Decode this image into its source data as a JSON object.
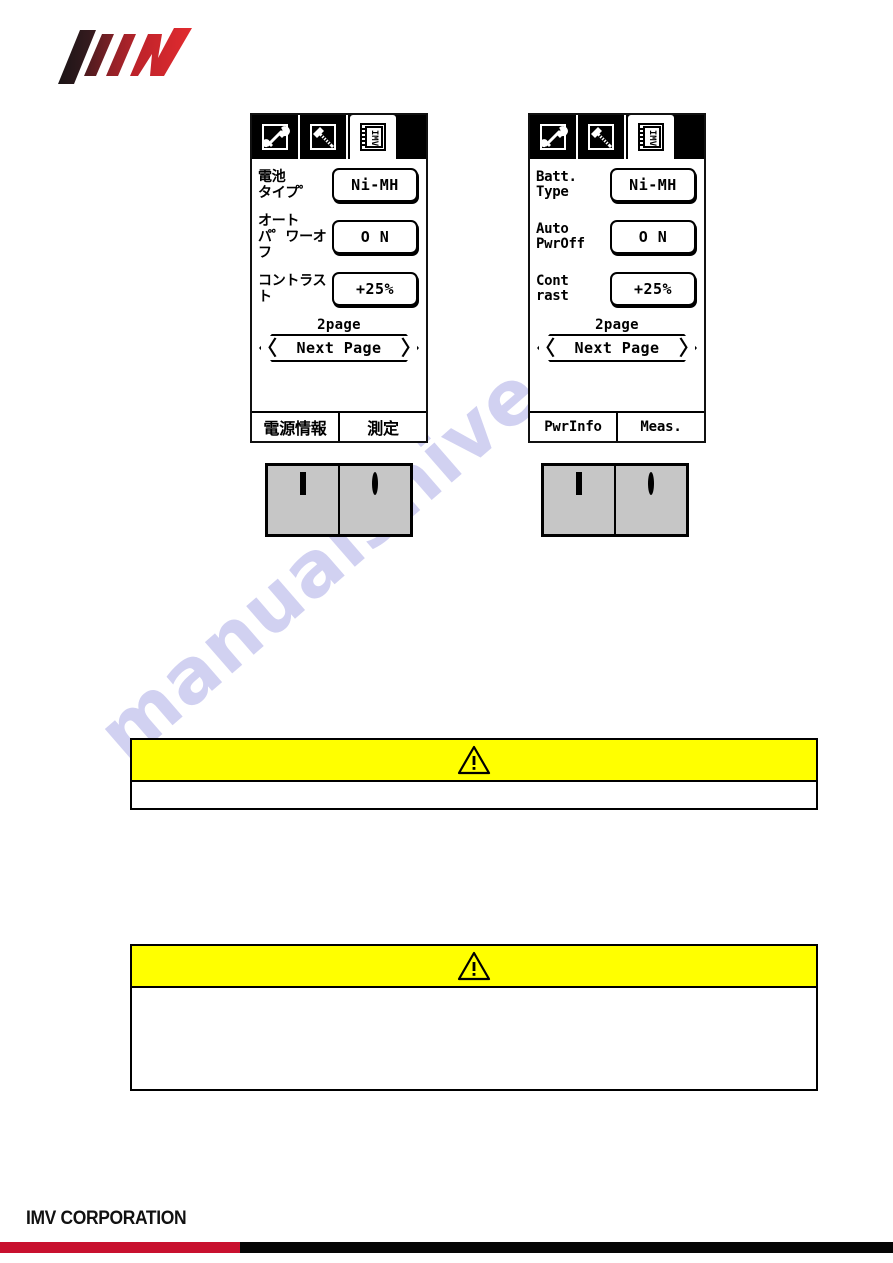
{
  "meta": {
    "watermark": "manualshive.com",
    "brand": "IMV",
    "accent_red": "#c8102e",
    "caution_yellow": "#ffff00",
    "key_panel_gray": "#c6c6c6"
  },
  "footer": {
    "company": "IMV CORPORATION"
  },
  "devices": [
    {
      "id": "japanese",
      "language": "ja",
      "tabs": [
        {
          "icon": "wrench-icon",
          "active": false
        },
        {
          "icon": "screwdriver-icon",
          "active": false
        },
        {
          "icon": "notebook-icon",
          "active": true
        }
      ],
      "settings": [
        {
          "label": "電池\nタイプ゜",
          "value": "Ni-MH"
        },
        {
          "label": "オート\nパ゜ワーオフ",
          "value": "O N"
        },
        {
          "label": "コントラスト",
          "value": "+25%"
        }
      ],
      "page_label": "2page",
      "next_page": "Next Page",
      "arrow_left": "〈",
      "arrow_right": "〉",
      "bottom_tabs": [
        {
          "label": "電源情報",
          "selected": true
        },
        {
          "label": "測定",
          "selected": false
        }
      ],
      "keys": [
        {
          "glyph": "square-icon"
        },
        {
          "glyph": "circle-icon"
        }
      ]
    },
    {
      "id": "english",
      "language": "en",
      "tabs": [
        {
          "icon": "wrench-icon",
          "active": false
        },
        {
          "icon": "screwdriver-icon",
          "active": false
        },
        {
          "icon": "notebook-icon",
          "active": true
        }
      ],
      "settings": [
        {
          "label": "Batt.\nType",
          "value": "Ni-MH"
        },
        {
          "label": "Auto\nPwrOff",
          "value": "O N"
        },
        {
          "label": "Cont\n rast",
          "value": "+25%"
        }
      ],
      "page_label": "2page",
      "next_page": "Next Page",
      "arrow_left": "〈",
      "arrow_right": "〉",
      "bottom_tabs": [
        {
          "label": "PwrInfo",
          "selected": true
        },
        {
          "label": "Meas.",
          "selected": false
        }
      ],
      "keys": [
        {
          "glyph": "square-icon"
        },
        {
          "glyph": "circle-icon"
        }
      ]
    }
  ],
  "cautions": [
    {
      "id": "caution-1",
      "icon": "warning-triangle-icon",
      "title": "",
      "body": ""
    },
    {
      "id": "caution-2",
      "icon": "warning-triangle-icon",
      "title": "",
      "body": ""
    }
  ]
}
